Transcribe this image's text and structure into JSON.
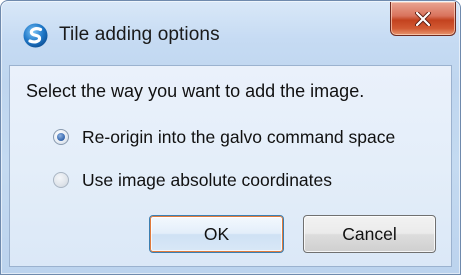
{
  "window": {
    "title": "Tile adding options",
    "app_icon": "app-logo-icon",
    "close_icon": "close-icon"
  },
  "dialog": {
    "prompt": "Select the way you want to add the image.",
    "options": [
      {
        "label": "Re-origin into the galvo command space",
        "checked": true
      },
      {
        "label": "Use image absolute coordinates",
        "checked": false
      }
    ]
  },
  "buttons": {
    "ok_label": "OK",
    "cancel_label": "Cancel"
  },
  "colors": {
    "title_bar": "#c6dbf3",
    "close_button": "#c3421f",
    "ok_focus_border": "#e07a3c",
    "radio_selected": "#3d6db3"
  }
}
